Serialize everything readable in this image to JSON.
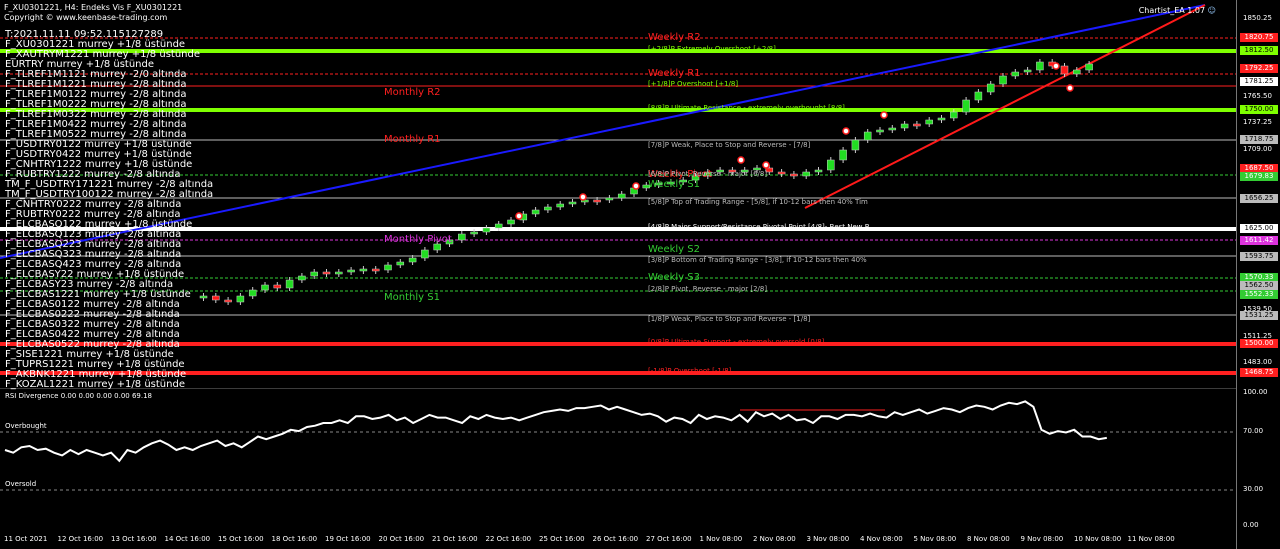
{
  "header": {
    "title": "F_XU0301221, H4:  Endeks Vis F_XU0301221",
    "copyright": "Copyright © www.keenbase-trading.com",
    "ea_label": "Chartist_EA 1.07"
  },
  "timestamp": "T:2021.11.11 09:52.115127289",
  "symbols": [
    "F_XU0301221 murrey +1/8 üstünde",
    "F_XAUTRYM1221 murrey +1/8 üstünde",
    "EURTRY murrey +1/8 üstünde",
    "F_TLREF1M1121 murrey -2/0 altında",
    "F_TLREF1M1221 murrey -2/8 altında",
    "F_TLREF1M0122 murrey -2/8 altında",
    "F_TLREF1M0222 murrey -2/8 altında",
    "F_TLREF1M0322 murrey -2/8 altında",
    "F_TLREF1M0422 murrey -2/8 altında",
    "F_TLREF1M0522 murrey -2/8 altında",
    "F_USDTRY0122 murrey +1/8 üstünde",
    "F_USDTRY0422 murrey +1/8 üstünde",
    "F_CNHTRY1222 murrey +1/8 üstünde",
    "F_RUBTRY1222 murrey -2/8 altında",
    "TM_F_USDTRY171221 murrey -2/8 altında",
    "TM_F_USDTRY100122 murrey -2/8 altında",
    "F_CNHTRY0222 murrey -2/8 altında",
    "F_RUBTRY0222 murrey -2/8 altında",
    "F_ELCBASQ122 murrey +1/8 üstünde",
    "F_ELCBASQ123 murrey -2/8 altında",
    "F_ELCBASQ223 murrey -2/8 altında",
    "F_ELCBASQ323 murrey -2/8 altında",
    "F_ELCBASQ423 murrey -2/8 altında",
    "F_ELCBASY22 murrey +1/8 üstünde",
    "F_ELCBASY23 murrey -2/8 altında",
    "F_ELCBAS1221 murrey +1/8 üstünde",
    "F_ELCBAS0122 murrey -2/8 altında",
    "F_ELCBAS0222 murrey -2/8 altında",
    "F_ELCBAS0322 murrey -2/8 altında",
    "F_ELCBAS0422 murrey -2/8 altında",
    "F_ELCBAS0522 murrey -2/8 altında",
    "F_SISE1221 murrey +1/8 üstünde",
    "F_TUPRS1221 murrey +1/8 üstünde",
    "F_AKBNK1221 murrey +1/8 üstünde",
    "F_KOZAL1221 murrey +1/8 üstünde"
  ],
  "murrey_levels": [
    {
      "label": "Weekly R2",
      "color": "#ff2020"
    },
    {
      "label": "[+2/8]P Extremely Overshoot [+2/8]",
      "color": "#7fff00"
    },
    {
      "label": "Weekly R1",
      "color": "#ff2020"
    },
    {
      "label": "[+1/8]P Overshoot [+1/8]",
      "color": "#7fff00"
    },
    {
      "label": "Monthly R2",
      "color": "#ff2020"
    },
    {
      "label": "[8/8]P Ultimate Resistance - extremely overbought [8/8]",
      "color": "#7fff00"
    },
    {
      "label": "Monthly R1",
      "color": "#ff2020"
    },
    {
      "label": "[7/8]P Weak, Place to Stop and Reverse - [7/8]",
      "color": "#bbbbbb"
    },
    {
      "label": "Weekly Pivot",
      "color": "#ff2020"
    },
    {
      "label": "[6/8]P Pivot, Reverse - major [6/8]",
      "color": "#bbbbbb"
    },
    {
      "label": "Weekly S1",
      "color": "#33cc33"
    },
    {
      "label": "[5/8]P Top of Trading Range - [5/8], if 10-12 bars then 40% Tim",
      "color": "#bbbbbb"
    },
    {
      "label": "[4/8]P Major Support/Resistance Pivotal Point [4/8]- Best New B",
      "color": "#ffffff"
    },
    {
      "label": "Monthly Pivot",
      "color": "#dd33dd"
    },
    {
      "label": "Weekly S2",
      "color": "#33cc33"
    },
    {
      "label": "[3/8]P Bottom of Trading Range - [3/8], if 10-12 bars then 40%",
      "color": "#bbbbbb"
    },
    {
      "label": "Weekly S3",
      "color": "#33cc33"
    },
    {
      "label": "[2/8]P Pivot, Reverse - major [2/8]",
      "color": "#bbbbbb"
    },
    {
      "label": "Monthly S1",
      "color": "#33cc33"
    },
    {
      "label": "[1/8]P Weak, Place to Stop and Reverse - [1/8]",
      "color": "#bbbbbb"
    },
    {
      "label": "[0/8]P Ultimate Support - extremely oversold [0/8]",
      "color": "#ff2020"
    },
    {
      "label": "[-1/8]P Overshoot [-1/8]",
      "color": "#ff2020"
    }
  ],
  "price_axis": {
    "ticks": [
      "1850.25",
      "1765.50",
      "1737.25",
      "1709.00",
      "1625.00",
      "1539.50",
      "1511.25",
      "1483.00"
    ],
    "tags": [
      {
        "text": "1820.75",
        "color": "#ff2020"
      },
      {
        "text": "1812.50",
        "color": "#7fff00"
      },
      {
        "text": "1792.25",
        "color": "#ff2020"
      },
      {
        "text": "1781.25",
        "color": "#ffffff"
      },
      {
        "text": "1750.00",
        "color": "#7fff00"
      },
      {
        "text": "1718.75",
        "color": "#bbbbbb"
      },
      {
        "text": "1687.50",
        "color": "#ff2020"
      },
      {
        "text": "1679.83",
        "color": "#33cc33"
      },
      {
        "text": "1656.25",
        "color": "#bbbbbb"
      },
      {
        "text": "1625.00",
        "color": "#ffffff"
      },
      {
        "text": "1611.42",
        "color": "#dd33dd"
      },
      {
        "text": "1593.75",
        "color": "#bbbbbb"
      },
      {
        "text": "1570.33",
        "color": "#33cc33"
      },
      {
        "text": "1562.50",
        "color": "#bbbbbb"
      },
      {
        "text": "1552.33",
        "color": "#33cc33"
      },
      {
        "text": "1531.25",
        "color": "#bbbbbb"
      },
      {
        "text": "1500.00",
        "color": "#ff2020"
      },
      {
        "text": "1468.75",
        "color": "#ff2020"
      }
    ]
  },
  "rsi": {
    "title": "RSI Divergence 0.00 0.00 0.00 0.00 69.18",
    "overbought": "Overbought",
    "oversold": "Oversold",
    "ticks": [
      "100.00",
      "70.00",
      "30.00",
      "0.00"
    ]
  },
  "time_axis": [
    "11 Oct 2021",
    "12 Oct 16:00",
    "13 Oct 16:00",
    "14 Oct 16:00",
    "15 Oct 16:00",
    "18 Oct 16:00",
    "19 Oct 16:00",
    "20 Oct 16:00",
    "21 Oct 16:00",
    "22 Oct 16:00",
    "25 Oct 16:00",
    "26 Oct 16:00",
    "27 Oct 16:00",
    "1 Nov 08:00",
    "2 Nov 08:00",
    "3 Nov 08:00",
    "4 Nov 08:00",
    "5 Nov 08:00",
    "8 Nov 08:00",
    "9 Nov 08:00",
    "10 Nov 08:00",
    "11 Nov 08:00"
  ],
  "colors": {
    "bull": "#22dd22",
    "bear": "#ff1a1a",
    "trend_blue": "#1a1aff",
    "trend_red": "#ff1a1a",
    "strong_green": "#7fff00"
  }
}
